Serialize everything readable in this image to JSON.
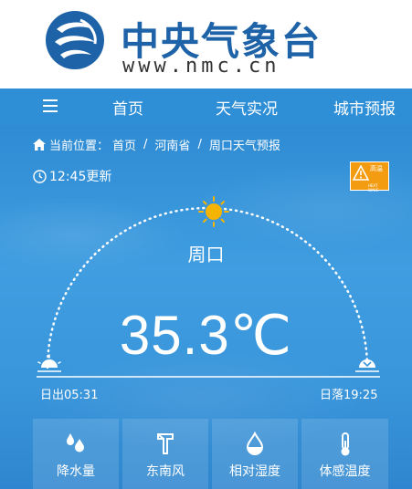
{
  "header": {
    "title": "中央气象台",
    "url": "www.nmc.cn",
    "logo_icon": "nmc-logo-icon"
  },
  "nav": {
    "menu_icon": "hamburger-icon",
    "items": [
      {
        "label": "首页"
      },
      {
        "label": "天气实况"
      },
      {
        "label": "城市预报"
      }
    ]
  },
  "breadcrumb": {
    "icon": "home-icon",
    "prefix": "当前位置：",
    "items": [
      "首页",
      "河南省",
      "周口天气预报"
    ],
    "separator": "/"
  },
  "update": {
    "icon": "clock-icon",
    "text": "12:45更新"
  },
  "alert_badge": {
    "icon": "warning-icon",
    "label": "高温",
    "sublabel": "HEAT WAVE",
    "color": "#f39c12"
  },
  "weather": {
    "city": "周口",
    "temperature": "35.3℃",
    "sun_icon": "sun-icon",
    "sunrise": "日出05:31",
    "sunset": "日落19:25",
    "sunrise_icon": "sunrise-icon",
    "sunset_icon": "sunset-icon"
  },
  "cards": [
    {
      "icon": "raindrop-icon",
      "label": "降水量"
    },
    {
      "icon": "wind-icon",
      "label": "东南风"
    },
    {
      "icon": "humidity-icon",
      "label": "相对湿度"
    },
    {
      "icon": "thermometer-icon",
      "label": "体感温度"
    }
  ],
  "colors": {
    "brand": "#1e63a8",
    "nav_bg": "#2e8fd7",
    "sky": "#3a96db",
    "sun": "#f5b400"
  }
}
